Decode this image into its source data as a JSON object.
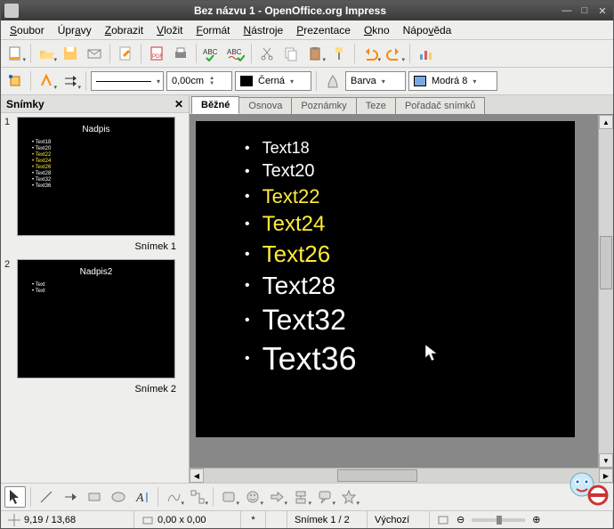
{
  "titlebar": {
    "title": "Bez názvu 1 - OpenOffice.org Impress"
  },
  "menu": {
    "file": "Soubor",
    "edit": "Úpravy",
    "view": "Zobrazit",
    "insert": "Vložit",
    "format": "Formát",
    "tools": "Nástroje",
    "presentation": "Prezentace",
    "window": "Okno",
    "help": "Nápověda"
  },
  "tb2": {
    "linewidth": "0,00cm",
    "linecolor_label": "Černá",
    "fill_label": "Barva",
    "fill_color": "Modrá 8"
  },
  "panel": {
    "title": "Snímky"
  },
  "slides": [
    {
      "num": "1",
      "label": "Snímek 1",
      "title": "Nadpis",
      "items": [
        {
          "t": "Text18",
          "y": false
        },
        {
          "t": "Text20",
          "y": false
        },
        {
          "t": "Text22",
          "y": true
        },
        {
          "t": "Text24",
          "y": true
        },
        {
          "t": "Text26",
          "y": true
        },
        {
          "t": "Text28",
          "y": false
        },
        {
          "t": "Text32",
          "y": false
        },
        {
          "t": "Text36",
          "y": false
        }
      ]
    },
    {
      "num": "2",
      "label": "Snímek 2",
      "title": "Nadpis2",
      "items": [
        {
          "t": "Text",
          "y": false
        },
        {
          "t": "Text",
          "y": false
        }
      ]
    }
  ],
  "tabs": {
    "normal": "Běžné",
    "outline": "Osnova",
    "notes": "Poznámky",
    "handouts": "Teze",
    "sorter": "Pořadač snímků"
  },
  "main_slide": {
    "items": [
      {
        "t": "Text18",
        "size": 18,
        "y": false
      },
      {
        "t": "Text20",
        "size": 20,
        "y": false
      },
      {
        "t": "Text22",
        "size": 22,
        "y": true
      },
      {
        "t": "Text24",
        "size": 24,
        "y": true
      },
      {
        "t": "Text26",
        "size": 26,
        "y": true
      },
      {
        "t": "Text28",
        "size": 28,
        "y": false
      },
      {
        "t": "Text32",
        "size": 32,
        "y": false
      },
      {
        "t": "Text36",
        "size": 36,
        "y": false
      }
    ]
  },
  "status": {
    "coords": "9,19 / 13,68",
    "size": "0,00 x 0,00",
    "modified": "*",
    "slide": "Snímek 1 / 2",
    "layout": "Výchozí"
  }
}
